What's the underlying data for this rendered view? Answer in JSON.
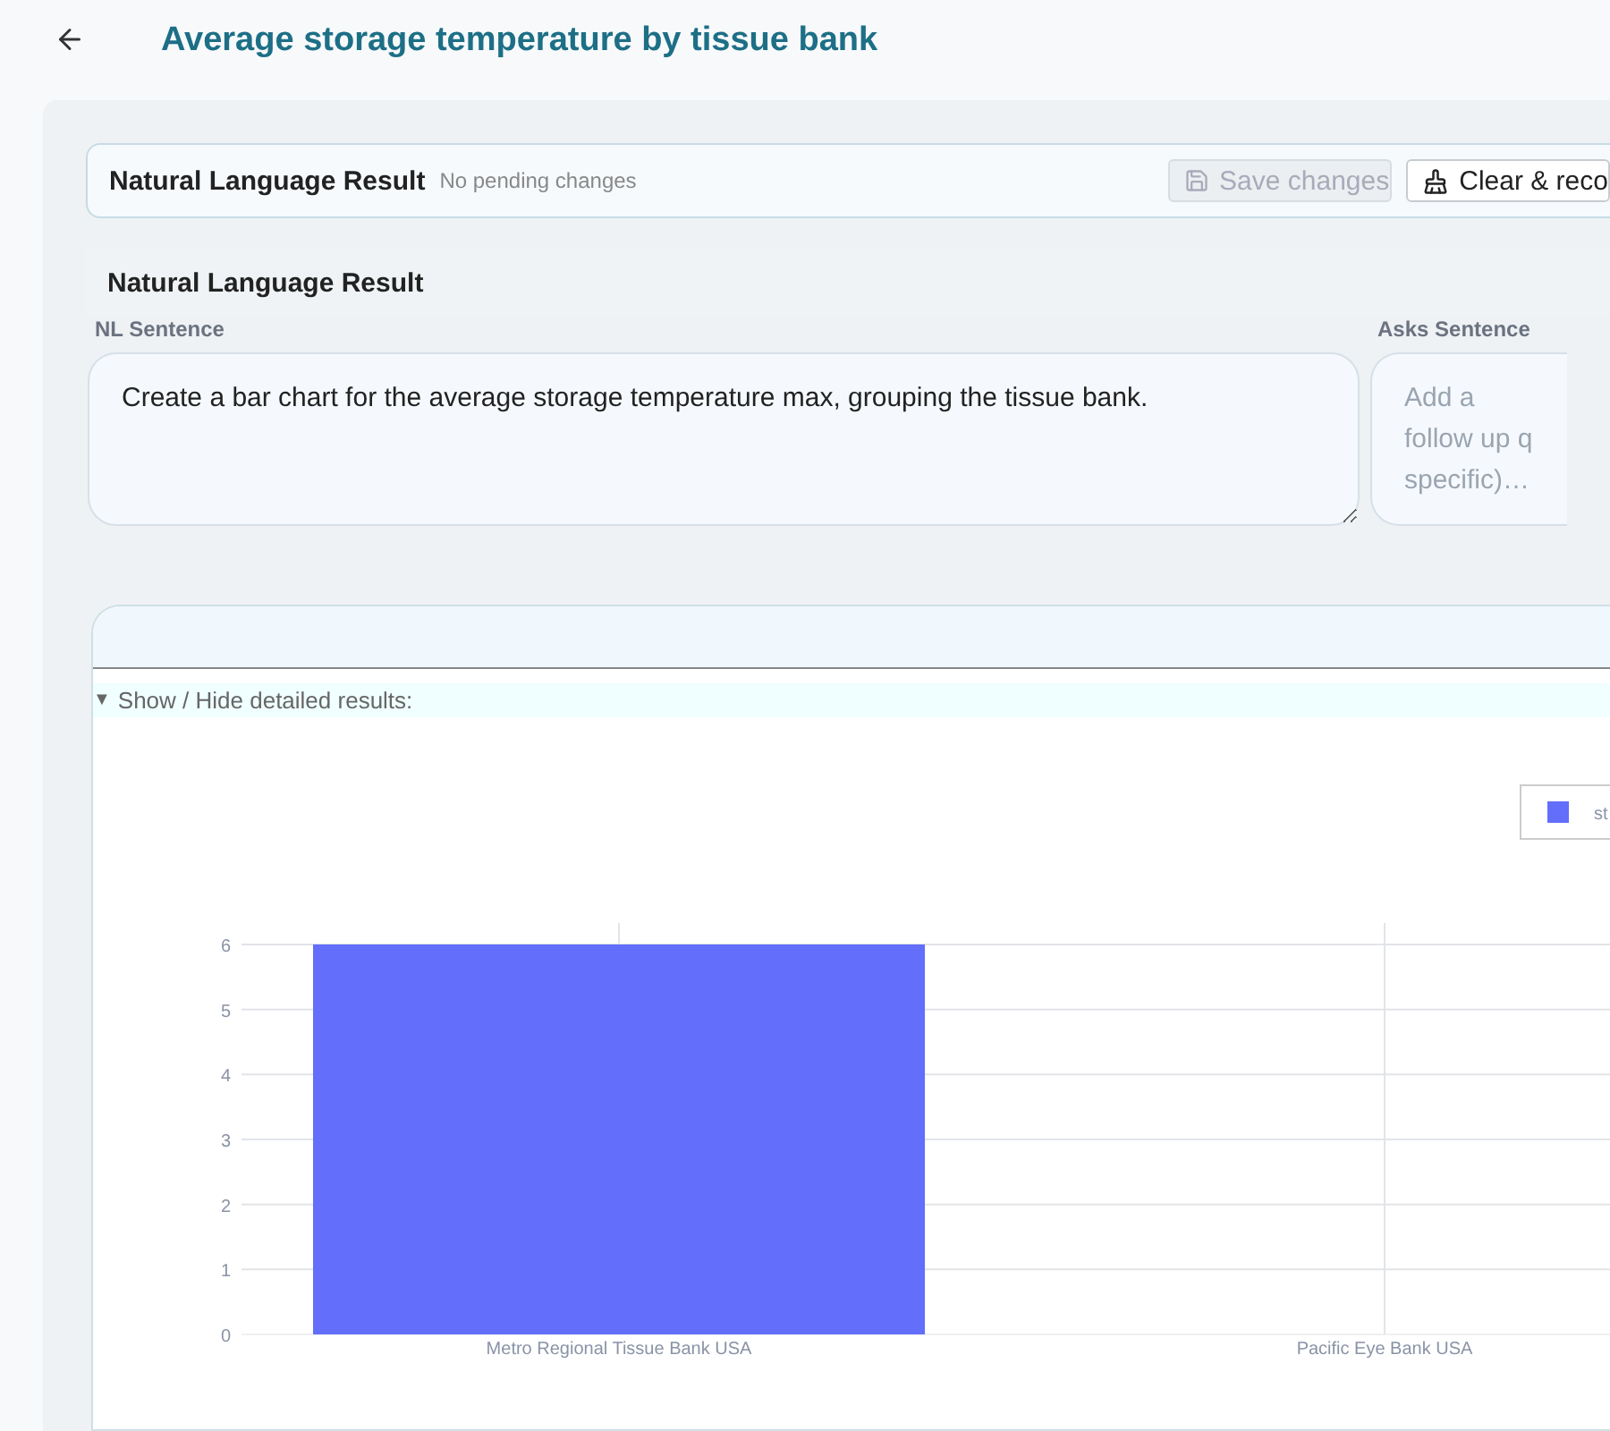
{
  "header": {
    "title": "Average storage temperature by tissue bank"
  },
  "toolbar": {
    "title": "Natural Language Result",
    "status": "No pending changes",
    "buttons": [
      {
        "label": "Save changes",
        "kind": "save",
        "disabled": true
      },
      {
        "label": "Clear & reco",
        "kind": "clear",
        "disabled": false
      }
    ]
  },
  "section": {
    "title": "Natural Language Result",
    "fields": [
      {
        "label": "NL Sentence",
        "value": "Create a bar chart for the average storage temperature max, grouping the tissue bank."
      },
      {
        "label": "Asks Sentence",
        "placeholder": "Add a follow up q specific)…"
      }
    ]
  },
  "results": {
    "toggle": {
      "icon": "▼",
      "label": "Show / Hide detailed results:",
      "expanded": true
    },
    "chart_data": {
      "type": "bar",
      "categories": [
        "Metro Regional Tissue Bank USA",
        "Pacific Eye Bank USA"
      ],
      "series": [
        {
          "name": "st",
          "color": "#636efa",
          "values": [
            6,
            0
          ]
        }
      ],
      "ylim": [
        0,
        6
      ],
      "yticks": [
        0,
        1,
        2,
        3,
        4,
        5,
        6
      ],
      "grid": true
    }
  }
}
